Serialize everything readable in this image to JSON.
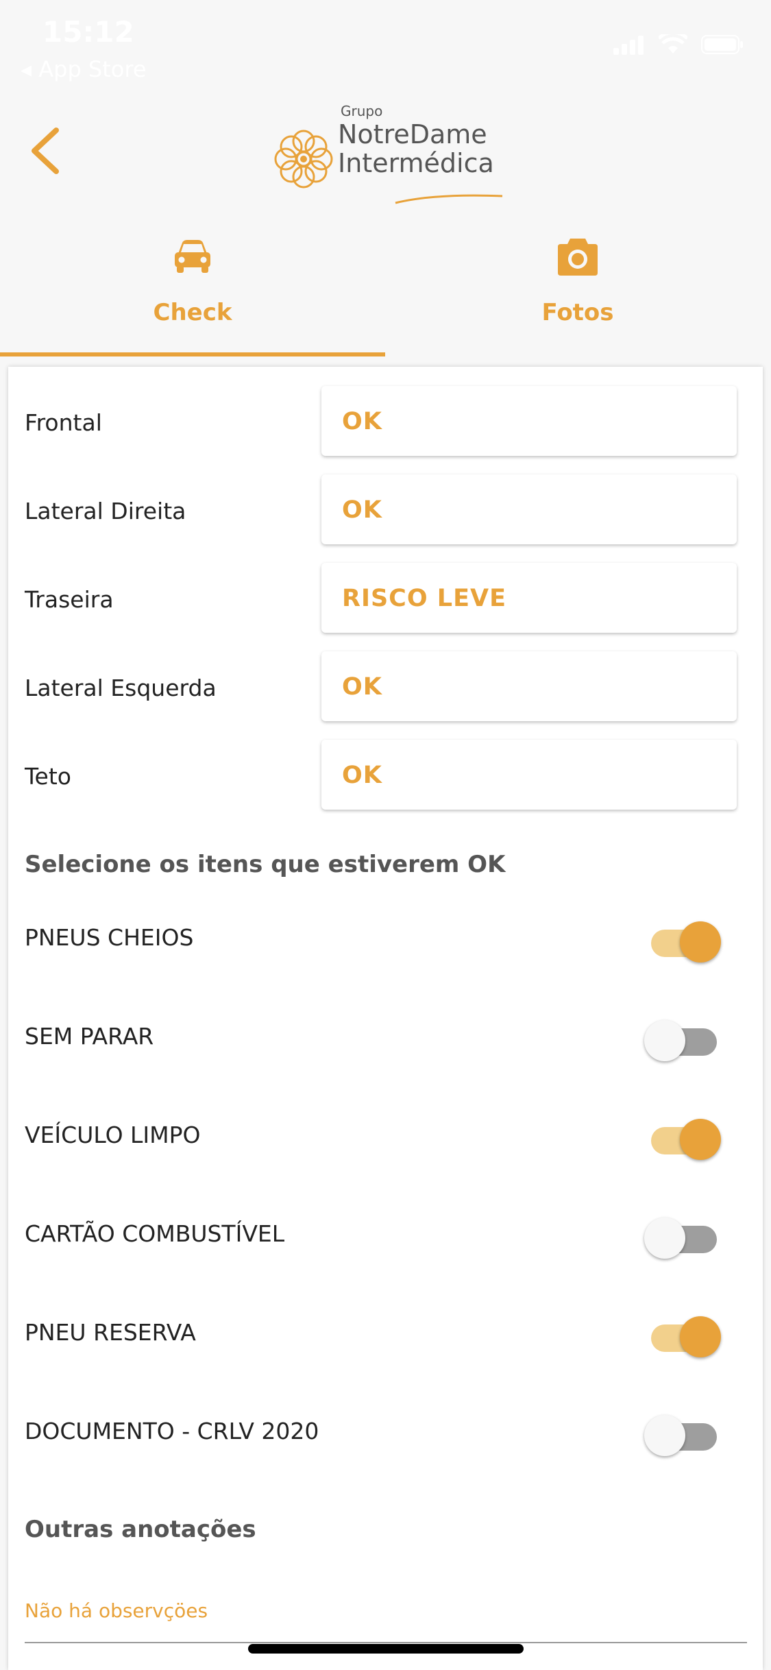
{
  "status_bar": {
    "time": "15:12",
    "back_app": "◂ App Store"
  },
  "header": {
    "logo": {
      "group_text": "Grupo",
      "line1": "NotreDame",
      "line2": "Intermédica"
    }
  },
  "tabs": [
    {
      "label": "Check",
      "icon": "car-icon",
      "active": true
    },
    {
      "label": "Fotos",
      "icon": "camera-icon",
      "active": false
    }
  ],
  "inspection": [
    {
      "label": "Frontal",
      "value": "OK"
    },
    {
      "label": "Lateral Direita",
      "value": "OK"
    },
    {
      "label": "Traseira",
      "value": "RISCO LEVE"
    },
    {
      "label": "Lateral Esquerda",
      "value": "OK"
    },
    {
      "label": "Teto",
      "value": "OK"
    }
  ],
  "checklist": {
    "title": "Selecione os itens que estiverem OK",
    "items": [
      {
        "label": "PNEUS CHEIOS",
        "checked": true
      },
      {
        "label": "SEM PARAR",
        "checked": false
      },
      {
        "label": "VEÍCULO LIMPO",
        "checked": true
      },
      {
        "label": "CARTÃO COMBUSTÍVEL",
        "checked": false
      },
      {
        "label": "PNEU RESERVA",
        "checked": true
      },
      {
        "label": "DOCUMENTO - CRLV 2020",
        "checked": false
      }
    ]
  },
  "notes": {
    "title": "Outras anotações",
    "placeholder": "Não há observçöes"
  },
  "colors": {
    "accent": "#e8a23a",
    "accent_light": "#f2d08c",
    "text": "#222222",
    "background": "#f7f7f7"
  }
}
